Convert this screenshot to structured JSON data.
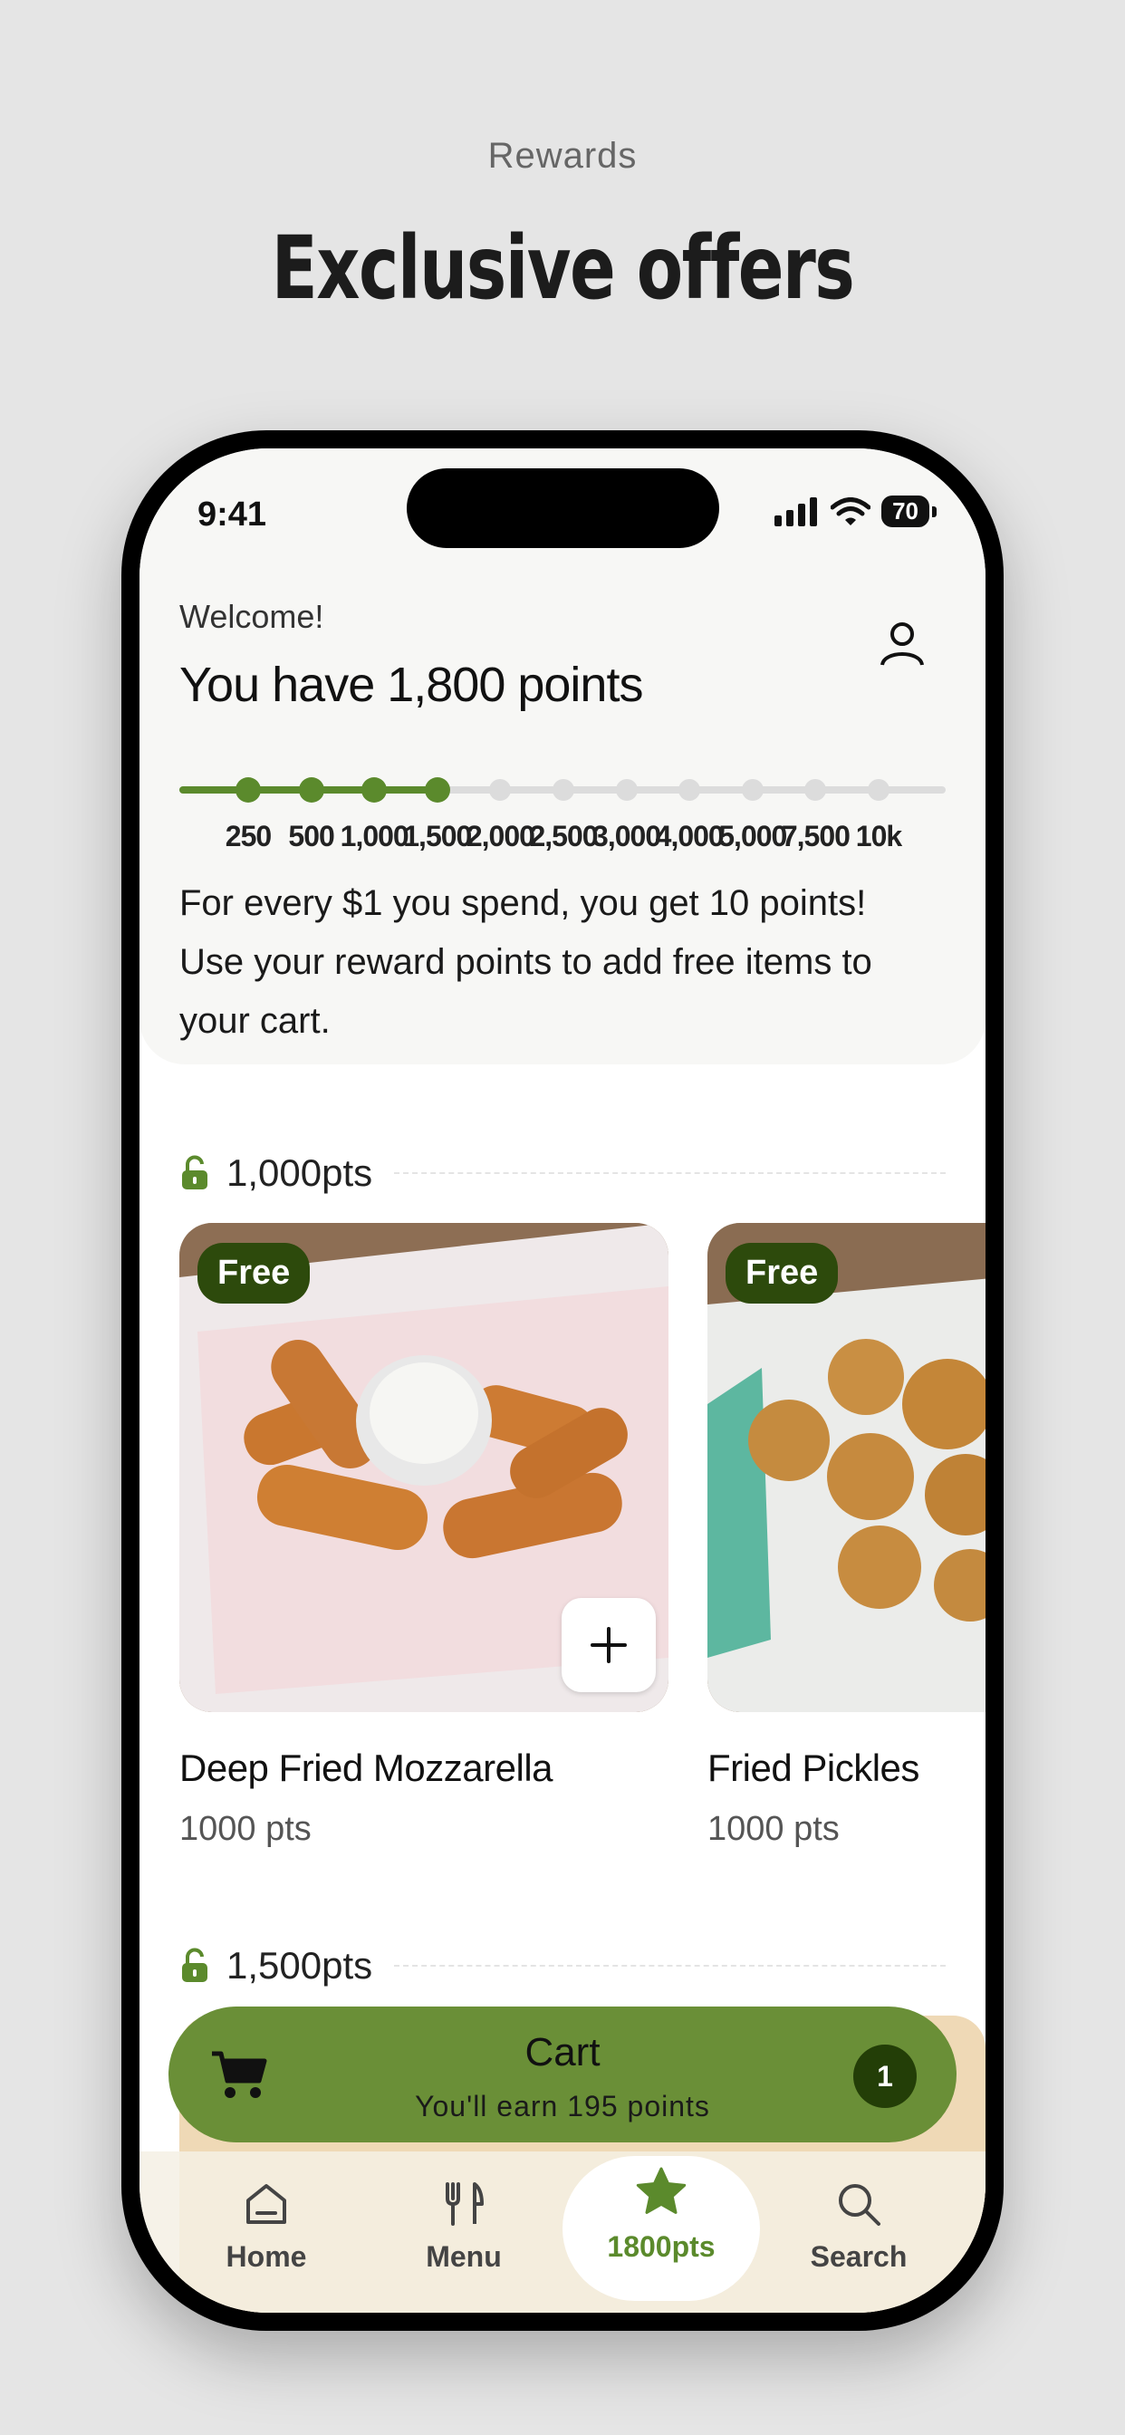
{
  "promo": {
    "subtitle": "Rewards",
    "title": "Exclusive offers"
  },
  "status_bar": {
    "time": "9:41",
    "battery": "70"
  },
  "header": {
    "welcome": "Welcome!",
    "points_title": "You have 1,800 points",
    "description": "For every $1 you spend, you get 10 points! Use your reward points to add free items to your cart."
  },
  "progress": {
    "current_points": 1800,
    "ticks": [
      "250",
      "500",
      "1,000",
      "1,500",
      "2,000",
      "2,500",
      "3,000",
      "4,000",
      "5,000",
      "7,500",
      "10k"
    ],
    "reached_count": 4
  },
  "tiers": [
    {
      "label": "1,000pts",
      "items": [
        {
          "badge": "Free",
          "name": "Deep Fried Mozzarella",
          "points": "1000 pts",
          "image": "mozzarella-sticks-photo"
        },
        {
          "badge": "Free",
          "name": "Fried Pickles",
          "points": "1000 pts",
          "image": "fried-pickles-photo"
        }
      ]
    },
    {
      "label": "1,500pts"
    }
  ],
  "cart": {
    "title": "Cart",
    "subtitle": "You'll earn 195 points",
    "count": "1"
  },
  "tabbar": {
    "home": "Home",
    "menu": "Menu",
    "points": "1800pts",
    "search": "Search"
  },
  "colors": {
    "accent": "#5b8a2c",
    "cart_bar": "#6a8f37",
    "badge": "#2d4a0c"
  }
}
